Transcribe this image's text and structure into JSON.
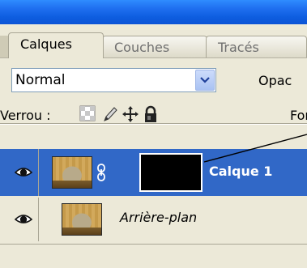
{
  "tabs": [
    {
      "label": "Calques",
      "active": true
    },
    {
      "label": "Couches",
      "active": false
    },
    {
      "label": "Tracés",
      "active": false
    }
  ],
  "blend": {
    "mode_value": "Normal",
    "opacity_label": "Opac"
  },
  "lock": {
    "label": "Verrou :",
    "icons": [
      "lock-transparency-icon",
      "lock-image-icon",
      "lock-position-icon",
      "lock-all-icon"
    ],
    "fill_label": "For"
  },
  "layers": [
    {
      "name": "Calque 1",
      "selected": true,
      "visible": true,
      "has_mask": true,
      "mask_color": "#000000"
    },
    {
      "name": "Arrière-plan",
      "selected": false,
      "visible": true,
      "has_mask": false
    }
  ],
  "colors": {
    "title_bar": "#0b54d6",
    "panel_bg": "#ece9d8",
    "selection": "#3168c7"
  }
}
